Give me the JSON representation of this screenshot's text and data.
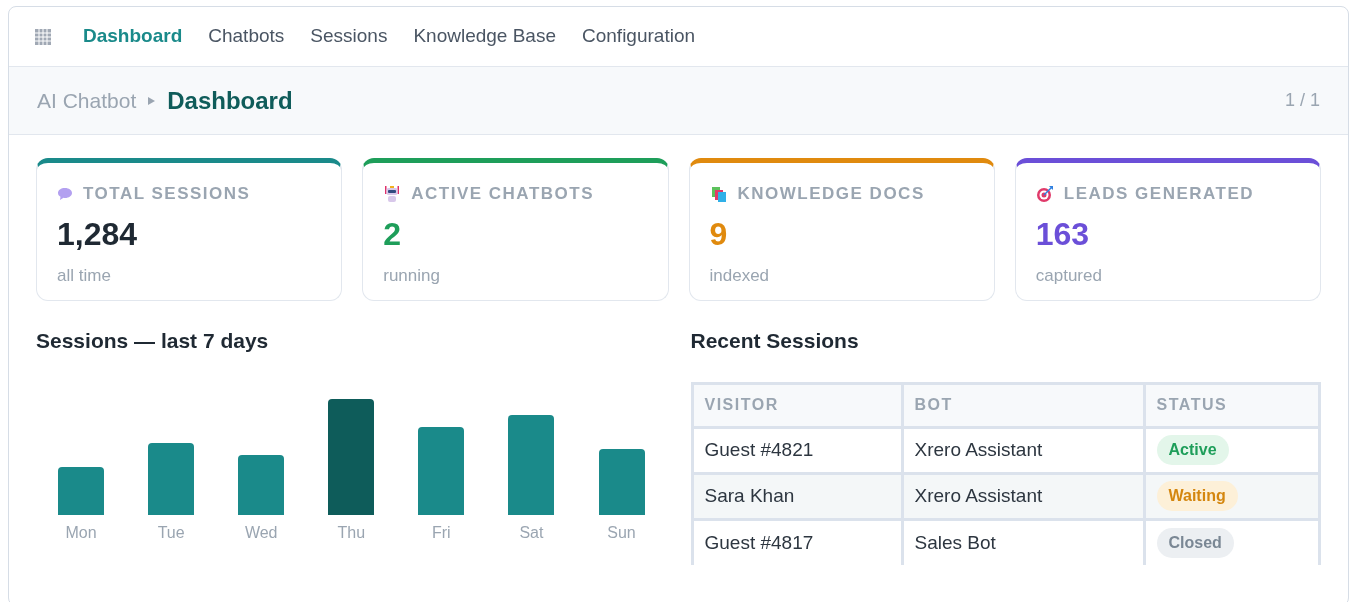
{
  "nav": {
    "items": [
      {
        "label": "Dashboard",
        "selected": true
      },
      {
        "label": "Chatbots",
        "selected": false
      },
      {
        "label": "Sessions",
        "selected": false
      },
      {
        "label": "Knowledge Base",
        "selected": false
      },
      {
        "label": "Configuration",
        "selected": false
      }
    ]
  },
  "breadcrumb": {
    "parent": "AI Chatbot",
    "current": "Dashboard",
    "pager": "1 / 1"
  },
  "cards": [
    {
      "kind": "chat",
      "title": "TOTAL SESSIONS",
      "value": "1,284",
      "caption": "all time",
      "color": "#1a8a8a"
    },
    {
      "kind": "robot",
      "title": "ACTIVE CHATBOTS",
      "value": "2",
      "caption": "running",
      "color": "#1e9e5a"
    },
    {
      "kind": "books",
      "title": "KNOWLEDGE DOCS",
      "value": "9",
      "caption": "indexed",
      "color": "#e08a0e"
    },
    {
      "kind": "target",
      "title": "LEADS GENERATED",
      "value": "163",
      "caption": "captured",
      "color": "#6b4fd8"
    }
  ],
  "chart": {
    "title": "Sessions — last 7 days",
    "days": [
      {
        "label": "Mon",
        "selected": false
      },
      {
        "label": "Tue",
        "selected": false
      },
      {
        "label": "Wed",
        "selected": false
      },
      {
        "label": "Thu",
        "selected": true
      },
      {
        "label": "Fri",
        "selected": false
      },
      {
        "label": "Sat",
        "selected": false
      },
      {
        "label": "Sun",
        "selected": false
      }
    ]
  },
  "recent": {
    "title": "Recent Sessions",
    "columns": [
      "VISITOR",
      "BOT",
      "STATUS"
    ],
    "rows": [
      {
        "visitor": "Guest #4821",
        "bot": "Xrero Assistant",
        "status": "Active",
        "kind": "active"
      },
      {
        "visitor": "Sara Khan",
        "bot": "Xrero Assistant",
        "status": "Waiting",
        "kind": "waiting"
      },
      {
        "visitor": "Guest #4817",
        "bot": "Sales Bot",
        "status": "Closed",
        "kind": "closed"
      }
    ]
  }
}
